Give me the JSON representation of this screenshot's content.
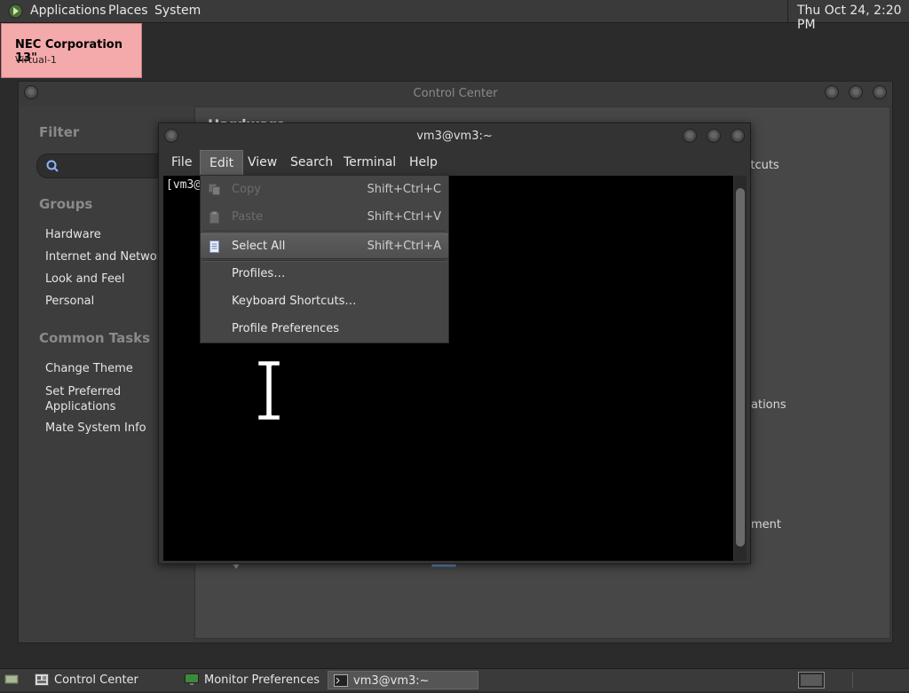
{
  "top_panel": {
    "menus": [
      "Applications",
      "Places",
      "System"
    ],
    "clock": "Thu Oct 24,  2:20 PM"
  },
  "monitor_label": {
    "name": "NEC Corporation 13\"",
    "connector": "Virtual-1"
  },
  "control_center": {
    "title": "Control Center",
    "sidebar": {
      "filter_heading": "Filter",
      "groups_heading": "Groups",
      "groups": [
        "Hardware",
        "Internet and Network",
        "Look and Feel",
        "Personal"
      ],
      "tasks_heading": "Common Tasks",
      "tasks": [
        "Change Theme",
        "Set Preferred Applications",
        "Mate System Info"
      ]
    },
    "main": {
      "section_heading": "Hardware",
      "partial_items": [
        "rtcuts",
        "ations",
        "ment"
      ]
    }
  },
  "terminal": {
    "title": "vm3@vm3:~",
    "menus": [
      "File",
      "Edit",
      "View",
      "Search",
      "Terminal",
      "Help"
    ],
    "active_menu": "Edit",
    "prompt": "[vm3@"
  },
  "edit_menu": {
    "items": [
      {
        "label": "Copy",
        "accel": "Shift+Ctrl+C",
        "enabled": false,
        "icon": "copy-icon"
      },
      {
        "label": "Paste",
        "accel": "Shift+Ctrl+V",
        "enabled": false,
        "icon": "paste-icon"
      },
      {
        "label": "Select All",
        "accel": "Shift+Ctrl+A",
        "enabled": true,
        "icon": "select-all-icon",
        "highlighted": true
      },
      {
        "label": "Profiles…",
        "accel": "",
        "enabled": true
      },
      {
        "label": "Keyboard Shortcuts…",
        "accel": "",
        "enabled": true
      },
      {
        "label": "Profile Preferences",
        "accel": "",
        "enabled": true
      }
    ]
  },
  "taskbar": {
    "tasks": [
      {
        "label": "Control Center",
        "icon": "control-center-icon",
        "active": false
      },
      {
        "label": "Monitor Preferences",
        "icon": "monitor-icon",
        "active": false
      },
      {
        "label": "vm3@vm3:~",
        "icon": "terminal-icon",
        "active": true
      }
    ]
  },
  "colors": {
    "monitor_label_bg": "#f4aaaa",
    "panel_bg": "#3a3a3a",
    "terminal_bg": "#000000"
  }
}
